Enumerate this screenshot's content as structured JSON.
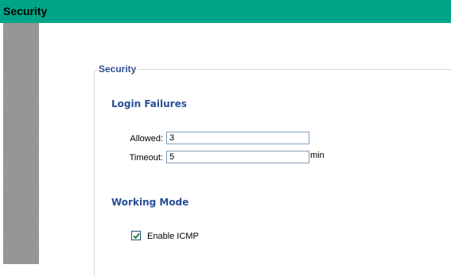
{
  "window": {
    "title": "Security"
  },
  "security": {
    "legend": "Security",
    "login_failures": {
      "title": "Login Failures",
      "allowed_label": "Allowed:",
      "allowed_value": "3",
      "timeout_label": "Timeout:",
      "timeout_value": "5",
      "timeout_unit": "min"
    },
    "working_mode": {
      "title": "Working Mode",
      "enable_icmp_label": "Enable ICMP",
      "enable_icmp_checked": true
    }
  },
  "colors": {
    "titlebar": "#00a487",
    "section_title": "#2a4f96"
  }
}
